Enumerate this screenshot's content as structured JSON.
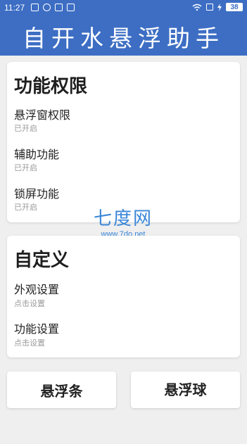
{
  "status_bar": {
    "time": "11:27",
    "battery": "38"
  },
  "header": {
    "title": "自开水悬浮助手"
  },
  "permissions": {
    "title": "功能权限",
    "items": [
      {
        "label": "悬浮窗权限",
        "status": "已开启"
      },
      {
        "label": "辅助功能",
        "status": "已开启"
      },
      {
        "label": "锁屏功能",
        "status": "已开启"
      }
    ]
  },
  "custom": {
    "title": "自定义",
    "items": [
      {
        "label": "外观设置",
        "hint": "点击设置"
      },
      {
        "label": "功能设置",
        "hint": "点击设置"
      }
    ]
  },
  "buttons": {
    "float_bar": "悬浮条",
    "float_ball": "悬浮球"
  },
  "watermark": {
    "name": "七度网",
    "url": "www.7do.net"
  },
  "colors": {
    "header": "#3d6ec4",
    "background": "#efefef",
    "watermark": "#3a86d8"
  }
}
